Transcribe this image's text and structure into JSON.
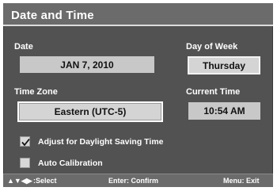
{
  "window": {
    "title": "Date and Time"
  },
  "fields": {
    "date": {
      "label": "Date",
      "value": "JAN 7, 2010"
    },
    "day_of_week": {
      "label": "Day of Week",
      "value": "Thursday"
    },
    "time_zone": {
      "label": "Time Zone",
      "value": "Eastern (UTC-5)"
    },
    "current_time": {
      "label": "Current Time",
      "value": "10:54 AM"
    }
  },
  "options": [
    {
      "label": "Adjust for Daylight Saving Time",
      "checked": true
    },
    {
      "label": "Auto Calibration",
      "checked": false
    }
  ],
  "footer": {
    "nav_arrows": "▲▼◀▶",
    "select": ":Select",
    "confirm": "Enter: Confirm",
    "exit": "Menu: Exit"
  }
}
